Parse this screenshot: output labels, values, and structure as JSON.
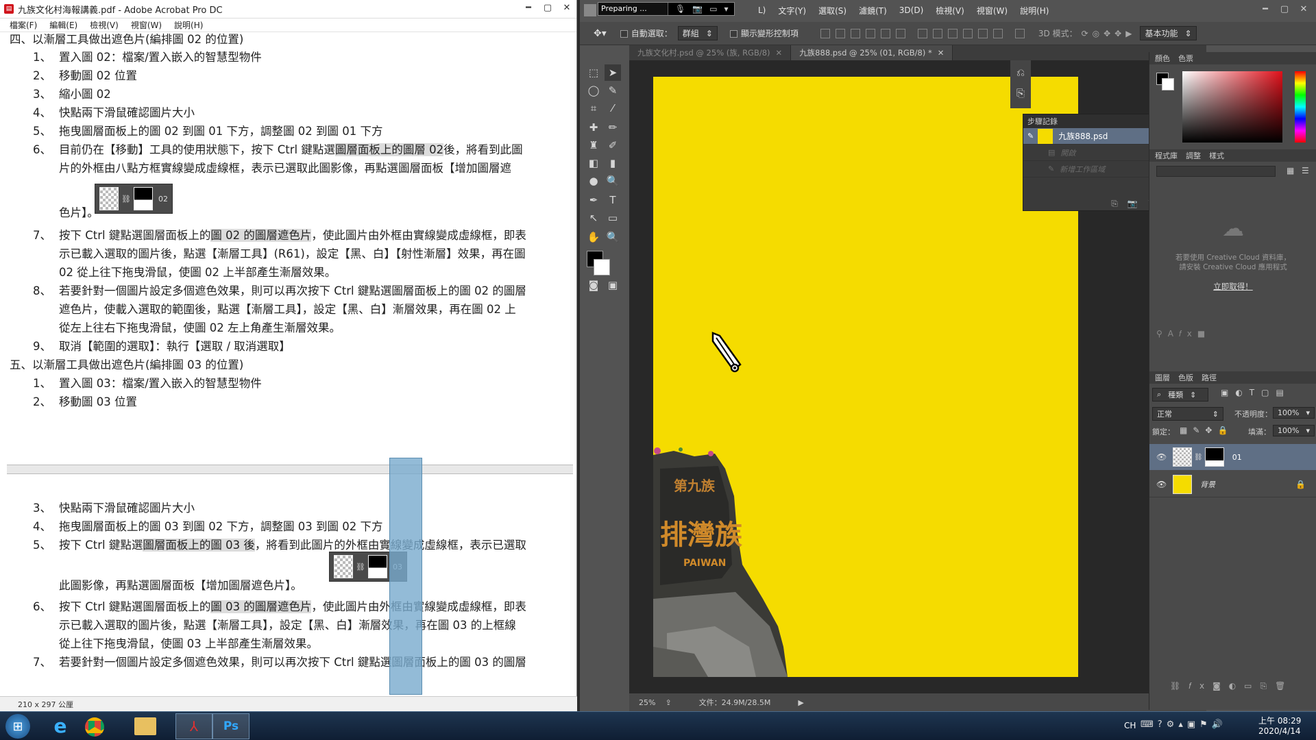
{
  "acrobat": {
    "title": "九族文化村海報講義.pdf - Adobe Acrobat Pro DC",
    "menu": [
      "檔案(F)",
      "編輯(E)",
      "檢視(V)",
      "視窗(W)",
      "說明(H)"
    ],
    "status_size": "210 x 297 公厘",
    "section4_heading": "四、以漸層工具做出遮色片(編排圖 02 的位置)",
    "section4_items": [
      {
        "num": "1、",
        "text": "置入圖 02：檔案/置入嵌入的智慧型物件"
      },
      {
        "num": "2、",
        "text": "移動圖 02 位置"
      },
      {
        "num": "3、",
        "text": "縮小圖 02"
      },
      {
        "num": "4、",
        "text": "快點兩下滑鼠確認圖片大小"
      },
      {
        "num": "5、",
        "text": "拖曳圖層面板上的圖 02 到圖 01 下方，調整圖 02 到圖 01 下方"
      }
    ],
    "item6": {
      "num": "6、",
      "part1": "目前仍在【移動】工具的使用狀態下，按下 Ctrl 鍵點選",
      "part1_hl": "圖層面板上的圖層 02",
      "part2": "後，將看到此圖",
      "line2": "片的外框由八點方框實線變成虛線框，表示已選取此圖影像，再點選圖層面板【增加圖層遮",
      "line3": "色片】。",
      "thumb_label": "02"
    },
    "item7": {
      "num": "7、",
      "part1": "按下 Ctrl 鍵點選圖層面板上的",
      "part1_hl": "圖 02 的圖層遮色片",
      "part2": "，使此圖片由外框由實線變成虛線框，即表",
      "line2": "示已載入選取的圖片後，點選【漸層工具】(R61)，設定【黑、白】【射性漸層】效果，再在圖",
      "line3": "02 從上往下拖曳滑鼠，使圖 02 上半部產生漸層效果。"
    },
    "item8": {
      "num": "8、",
      "line1": "若要針對一個圖片設定多個遮色效果，則可以再次按下 Ctrl 鍵點選圖層面板上的圖 02 的圖層",
      "line2": "遮色片，使載入選取的範圍後，點選【漸層工具】，設定【黑、白】漸層效果，再在圖 02 上",
      "line3": "從左上往右下拖曳滑鼠，使圖 02 左上角產生漸層效果。"
    },
    "item9": {
      "num": "9、",
      "text": "取消【範圍的選取】：執行【選取 / 取消選取】"
    },
    "section5_heading": "五、以漸層工具做出遮色片(編排圖 03 的位置)",
    "section5_items": [
      {
        "num": "1、",
        "text": "置入圖 03：檔案/置入嵌入的智慧型物件"
      },
      {
        "num": "2、",
        "text": "移動圖 03 位置"
      }
    ],
    "page2_items": [
      {
        "num": "3、",
        "text": "快點兩下滑鼠確認圖片大小"
      },
      {
        "num": "4、",
        "text": "拖曳圖層面板上的圖 03 到圖 02 下方，調整圖 03 到圖 02 下方"
      }
    ],
    "p2_item5": {
      "num": "5、",
      "part1": "按下 Ctrl 鍵點選",
      "part1_hl": "圖層面板上的圖 03 後",
      "part2": "，將看到此圖片的外框由實線變成虛線框，表示已選取",
      "line2": "此圖影像，再點選圖層面板【增加圖層遮色片】。",
      "thumb_label": "03"
    },
    "p2_item6": {
      "num": "6、",
      "part1": "按下 Ctrl 鍵點選圖層面板上的",
      "part1_hl": "圖 03 的圖層遮色片",
      "part2": "，使此圖片由外框由實線變成虛線框，即表",
      "line2": "示已載入選取的圖片後，點選【漸層工具】，設定【黑、白】漸層效果，再在圖 03 的上框線",
      "line3": "從上往下拖曳滑鼠，使圖 03 上半部產生漸層效果。"
    },
    "p2_item7": {
      "num": "7、",
      "line1": "若要針對一個圖片設定多個遮色效果，則可以再次按下 Ctrl 鍵點選圖層面板上的圖 03 的圖層"
    }
  },
  "photoshop": {
    "preparing": "Preparing ...",
    "menus": [
      "L)",
      "文字(Y)",
      "選取(S)",
      "濾鏡(T)",
      "3D(D)",
      "檢視(V)",
      "視窗(W)",
      "說明(H)"
    ],
    "options": {
      "auto_select": "自動選取：",
      "group": "群組",
      "show_transform": "顯示變形控制項",
      "mode3d": "3D 模式：",
      "workspace": "基本功能"
    },
    "tabs": [
      {
        "label": "九族文化村.psd @ 25% (族, RGB/8)",
        "active": false
      },
      {
        "label": "九族888.psd @ 25% (01, RGB/8) *",
        "active": true
      }
    ],
    "canvas_color": "#f5dc00",
    "status": {
      "zoom": "25%",
      "file": "文件：24.9M/28.5M"
    },
    "history": {
      "title": "步驟記錄",
      "snapshot": "九族888.psd",
      "rows": [
        "開啟",
        "新增工作區域"
      ]
    },
    "color_panel": {
      "tabs": [
        "顏色",
        "色票"
      ]
    },
    "library_panel": {
      "tabs": [
        "程式庫",
        "調整",
        "樣式"
      ],
      "msg1": "若要使用 Creative Cloud 資料庫，",
      "msg2": "請安裝 Creative Cloud 應用程式",
      "link": "立即取得！"
    },
    "layers_panel": {
      "tabs": [
        "圖層",
        "色版",
        "路徑"
      ],
      "kind": "種類",
      "blend": "正常",
      "opacity_label": "不透明度：",
      "opacity": "100%",
      "lock_label": "鎖定：",
      "fill_label": "填滿：",
      "fill": "100%",
      "layers": [
        {
          "name": "01",
          "selected": true
        },
        {
          "name": "背景",
          "selected": false
        }
      ]
    },
    "sign_text": {
      "top": "第九族",
      "main": "排灣族",
      "sub": "PAIWAN"
    }
  },
  "taskbar": {
    "lang": "CH",
    "time": "上午 08:29",
    "date": "2020/4/14"
  }
}
